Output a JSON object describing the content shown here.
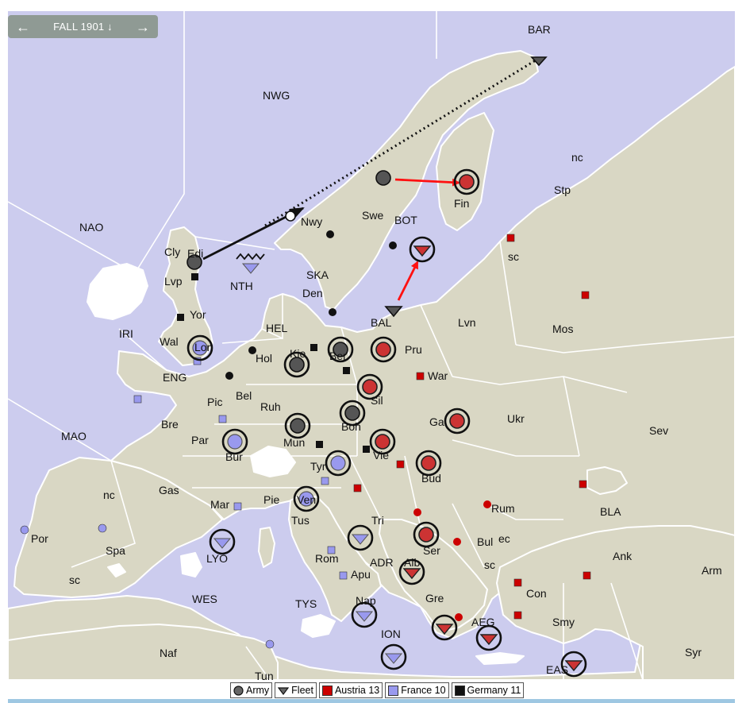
{
  "turn": {
    "label": "FALL 1901",
    "down_icon": "arrow-down-icon",
    "prev_icon": "arrow-left-icon",
    "next_icon": "arrow-right-icon"
  },
  "colors": {
    "sea": "#ccccee",
    "land": "#d9d7c4",
    "austria": "#cc0000",
    "france": "#9999ee",
    "germany": "#111111",
    "order_move": "#ff1111"
  },
  "provinces": {
    "NWG": "NWG",
    "BAR": "BAR",
    "NAO": "NAO",
    "Cly": "Cly",
    "Edi": "Edi",
    "Lvp": "Lvp",
    "NTH": "NTH",
    "Yor": "Yor",
    "IRI": "IRI",
    "Wal": "Wal",
    "Lon": "Lon",
    "ENG": "ENG",
    "SKA": "SKA",
    "Den": "Den",
    "HEL": "HEL",
    "Hol": "Hol",
    "Kie": "Kie",
    "Ber": "Ber",
    "BAL": "BAL",
    "Pru": "Pru",
    "Lvn": "Lvn",
    "Mos": "Mos",
    "Nwy": "Nwy",
    "Swe": "Swe",
    "BOT": "BOT",
    "Fin": "Fin",
    "nc": "nc",
    "Stp": "Stp",
    "sc": "sc",
    "Bel": "Bel",
    "Pic": "Pic",
    "Ruh": "Ruh",
    "Bre": "Bre",
    "Par": "Par",
    "Bur": "Bur",
    "Mun": "Mun",
    "Boh": "Boh",
    "Sil": "Sil",
    "War": "War",
    "Gal": "Gal",
    "Ukr": "Ukr",
    "Sev": "Sev",
    "MAO": "MAO",
    "Vie": "Vie",
    "Bud": "Bud",
    "Tyr": "Tyr",
    "Gas": "Gas",
    "Mar": "Mar",
    "Pie": "Pie",
    "Ven": "Ven",
    "Tri": "Tri",
    "Rum": "Rum",
    "BLA": "BLA",
    "Por": "Por",
    "Spa": "Spa",
    "LYO": "LYO",
    "Tus": "Tus",
    "Rom": "Rom",
    "Apu": "Apu",
    "ADR": "ADR",
    "Alb": "Alb",
    "Ser": "Ser",
    "Bul": "Bul",
    "ec": "ec",
    "Ank": "Ank",
    "Arm": "Arm",
    "WES": "WES",
    "TYS": "TYS",
    "Nap": "Nap",
    "Gre": "Gre",
    "Con": "Con",
    "ION": "ION",
    "AEG": "AEG",
    "Smy": "Smy",
    "Naf": "Naf",
    "Tun": "Tun",
    "EAS": "EAS",
    "Syr": "Syr"
  },
  "legend": {
    "army": "Army",
    "fleet": "Fleet",
    "austria": "Austria 13",
    "france": "France 10",
    "germany": "Germany 11"
  }
}
